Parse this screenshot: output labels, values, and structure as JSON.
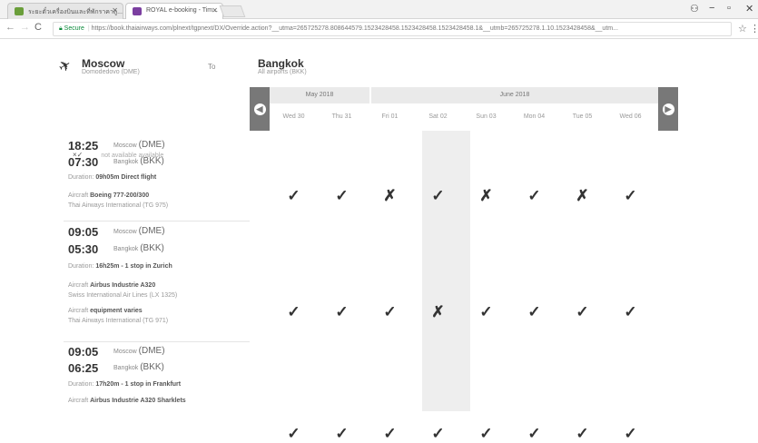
{
  "browser": {
    "tabs": [
      {
        "title": "ระยะตั๋วเครื่องบินและที่พักราคาถู..."
      },
      {
        "title": "ROYAL e-booking - Tim..."
      }
    ],
    "window_controls": {
      "profile": "⚇",
      "minimize": "−",
      "maximize": "▫",
      "close": "✕"
    },
    "nav": {
      "back": "←",
      "forward": "→",
      "reload": "C"
    },
    "address": {
      "secure_label": "Secure",
      "url": "https://book.thaiairways.com/plnext/tgpnext/DX/Override.action?__utma=265725278.808644579.1523428458.1523428458.1523428458.1&__utmb=265725278.1.10.1523428458&__utm..."
    }
  },
  "route": {
    "origin_city": "Moscow",
    "origin_airport": "Domodedovo (DME)",
    "to_label": "To",
    "dest_city": "Bangkok",
    "dest_airport": "All airports (BKK)"
  },
  "legend": {
    "mark": "×✓",
    "text": "not available available"
  },
  "calendar": {
    "months": [
      {
        "label": "May 2018"
      },
      {
        "label": "June 2018"
      }
    ],
    "days": [
      "Wed 30",
      "Thu 31",
      "Fri 01",
      "Sat 02",
      "Sun 03",
      "Mon 04",
      "Tue 05",
      "Wed 06"
    ],
    "prev_icon": "◀",
    "next_icon": "▶"
  },
  "flights": [
    {
      "depart_time": "18:25",
      "depart_city": "Moscow",
      "depart_code": "(DME)",
      "arrive_time": "07:30",
      "arrive_city": "Bangkok",
      "arrive_code": "(BKK)",
      "duration_label": "Duration:",
      "duration": "09h05m Direct flight",
      "legs": [
        {
          "aircraft_label": "Aircraft",
          "aircraft": "Boeing 777-200/300",
          "carrier": "Thai Airways International (TG 975)"
        }
      ],
      "availability": [
        "✓",
        "✓",
        "✗",
        "✓",
        "✗",
        "✓",
        "✗",
        "✓"
      ]
    },
    {
      "depart_time": "09:05",
      "depart_city": "Moscow",
      "depart_code": "(DME)",
      "arrive_time": "05:30",
      "arrive_city": "Bangkok",
      "arrive_code": "(BKK)",
      "duration_label": "Duration:",
      "duration": "16h25m - 1 stop in  Zurich",
      "legs": [
        {
          "aircraft_label": "Aircraft",
          "aircraft": "Airbus Industrie A320",
          "carrier": "Swiss International Air Lines (LX 1325)"
        },
        {
          "aircraft_label": "Aircraft",
          "aircraft": "equipment varies",
          "carrier": "Thai Airways International (TG 971)"
        }
      ],
      "availability": [
        "✓",
        "✓",
        "✓",
        "✗",
        "✓",
        "✓",
        "✓",
        "✓"
      ]
    },
    {
      "depart_time": "09:05",
      "depart_city": "Moscow",
      "depart_code": "(DME)",
      "arrive_time": "06:25",
      "arrive_city": "Bangkok",
      "arrive_code": "(BKK)",
      "duration_label": "Duration:",
      "duration": "17h20m - 1 stop in  Frankfurt",
      "legs": [
        {
          "aircraft_label": "Aircraft",
          "aircraft": "Airbus Industrie A320 Sharklets",
          "carrier": ""
        }
      ],
      "availability": [
        "✓",
        "✓",
        "✓",
        "✓",
        "✓",
        "✓",
        "✓",
        "✓"
      ]
    }
  ]
}
